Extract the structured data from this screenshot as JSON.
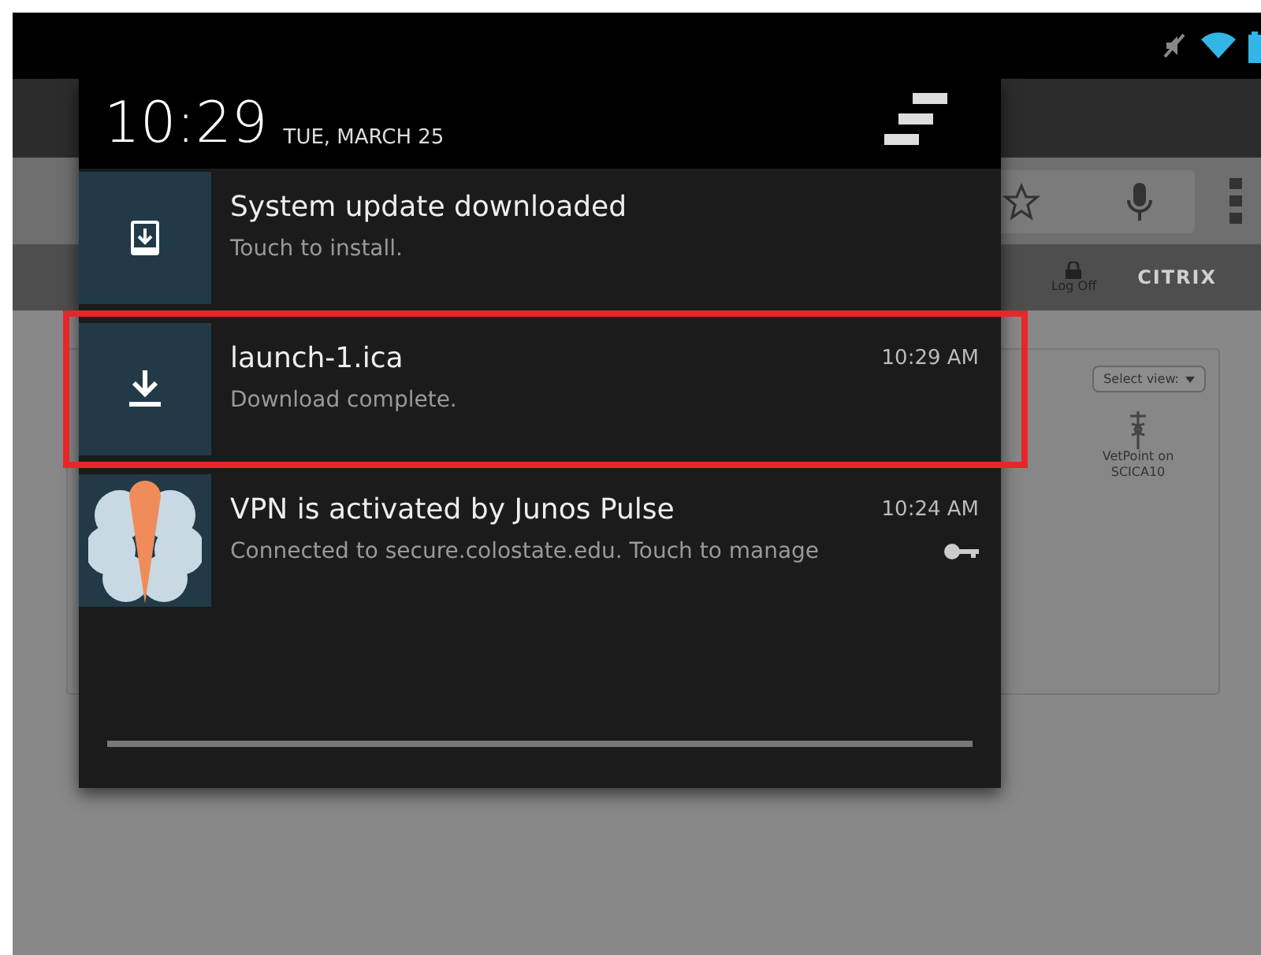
{
  "background_browser": {
    "toolbar_button": "Log Off",
    "logo": "CITRIX",
    "view_menu": "Select view:",
    "app_tile": "VetPoint on SCICA10"
  },
  "notification_shade": {
    "time": "10:29",
    "date": "TUE, MARCH 25"
  },
  "notifications": [
    {
      "kind": "update",
      "title": "System update downloaded",
      "text": "Touch to install.",
      "highlighted": false
    },
    {
      "kind": "download",
      "title": "launch-1.ica",
      "text": "Download complete.",
      "time": "10:29 AM",
      "highlighted": true
    },
    {
      "kind": "vpn",
      "title": "VPN is activated by Junos Pulse",
      "text": "Connected to secure.colostate.edu. Touch to manage",
      "time": "10:24 AM",
      "highlighted": false
    }
  ]
}
